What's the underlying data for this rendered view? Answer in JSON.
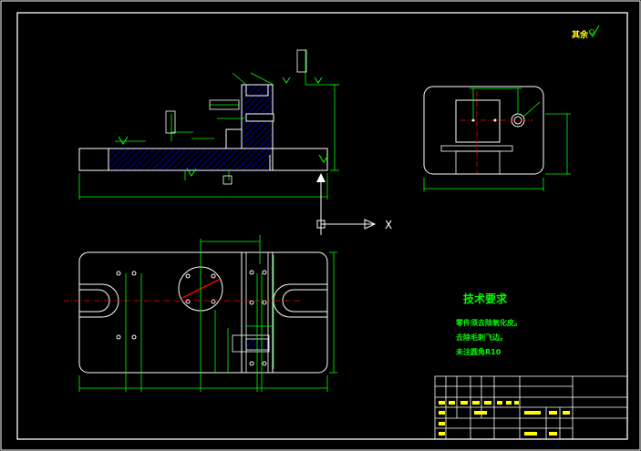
{
  "drawing": {
    "surface_roughness_note": "其余",
    "axis_label": "X",
    "notes": {
      "title": "技术要求",
      "items": [
        "零件须去除氧化皮。",
        "去除毛刺飞边。",
        "未注圆角R10"
      ]
    },
    "colors": {
      "background": "#000000",
      "outline": "#ffffff",
      "dimension": "#00ff00",
      "center": "#ff0000",
      "hatch": "#0000ff",
      "note_text": "#00ff00",
      "title_text": "#ffff00"
    }
  }
}
